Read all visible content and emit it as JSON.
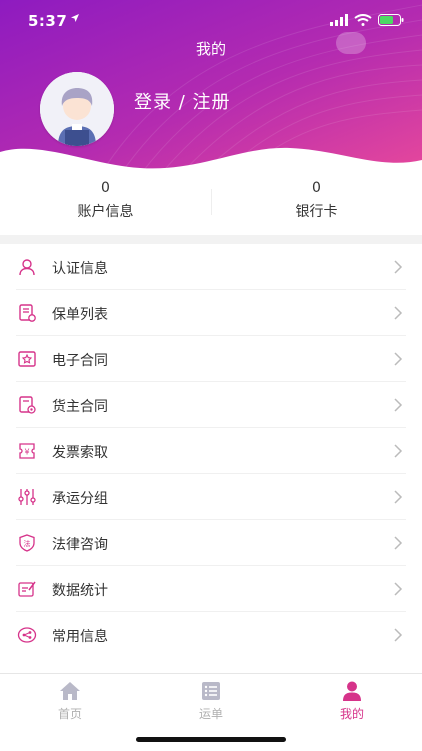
{
  "status_bar": {
    "time": "5:37"
  },
  "header": {
    "title": "我的",
    "login_text": "登录 / 注册"
  },
  "stats": [
    {
      "value": "0",
      "label": "账户信息"
    },
    {
      "value": "0",
      "label": "银行卡"
    }
  ],
  "menu": [
    {
      "label": "认证信息",
      "icon": "user-icon"
    },
    {
      "label": "保单列表",
      "icon": "policy-list-icon"
    },
    {
      "label": "电子合同",
      "icon": "e-contract-icon"
    },
    {
      "label": "货主合同",
      "icon": "shipper-contract-icon"
    },
    {
      "label": "发票索取",
      "icon": "invoice-icon"
    },
    {
      "label": "承运分组",
      "icon": "sliders-icon"
    },
    {
      "label": "法律咨询",
      "icon": "legal-icon"
    },
    {
      "label": "数据统计",
      "icon": "statistics-icon"
    },
    {
      "label": "常用信息",
      "icon": "share-icon"
    }
  ],
  "tabbar": [
    {
      "label": "首页",
      "icon": "home-icon"
    },
    {
      "label": "运单",
      "icon": "waybill-icon"
    },
    {
      "label": "我的",
      "icon": "profile-icon",
      "active": true
    }
  ],
  "colors": {
    "accent": "#d6338a",
    "header_start": "#8e1bc0",
    "header_end": "#e0449a"
  }
}
